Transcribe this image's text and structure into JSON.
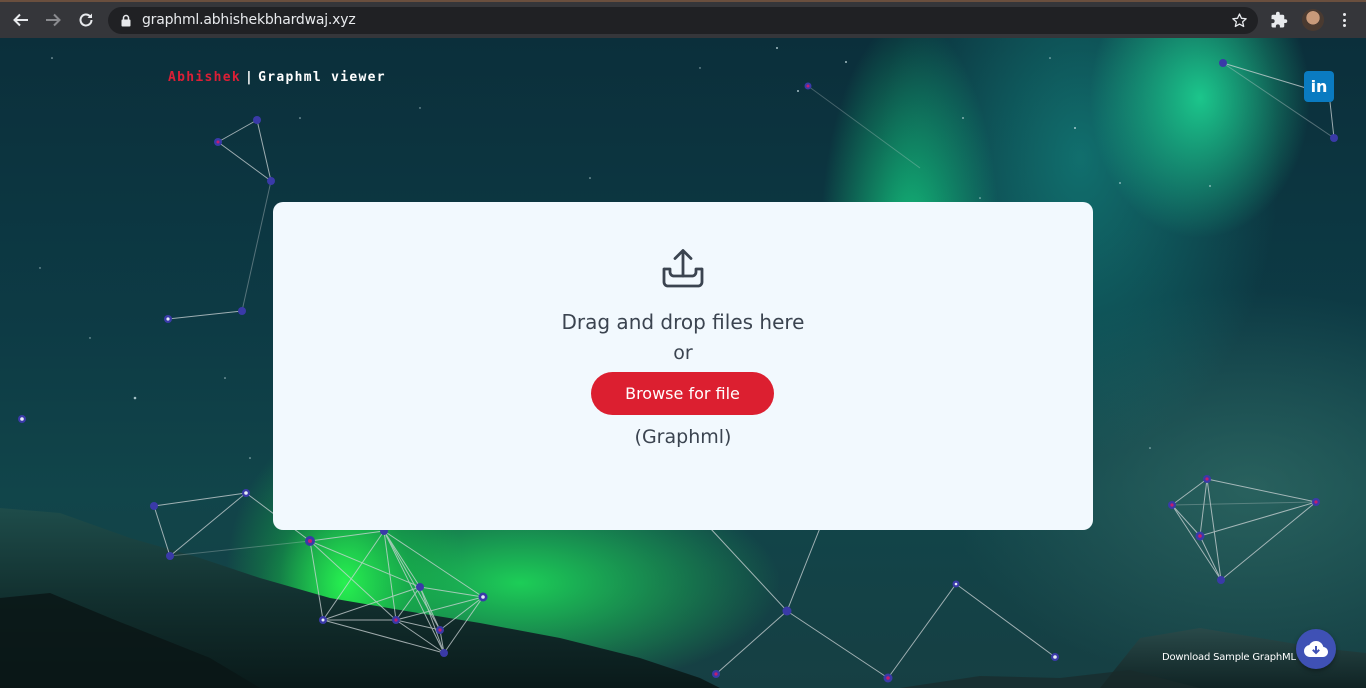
{
  "browser": {
    "url": "graphml.abhishekbhardwaj.xyz",
    "back_icon": "arrow-left-icon",
    "forward_icon": "arrow-right-icon",
    "reload_icon": "reload-icon",
    "lock_icon": "lock-icon",
    "bookmark_icon": "star-icon",
    "extensions_icon": "puzzle-icon",
    "profile_icon": "avatar",
    "menu_icon": "kebab-menu-icon"
  },
  "header": {
    "brand_name": "Abhishek",
    "separator": "|",
    "app_name": "Graphml viewer"
  },
  "social": {
    "linkedin_label": "in"
  },
  "dropzone": {
    "icon": "upload-tray-icon",
    "drag_text": "Drag and drop files here",
    "or_text": "or",
    "browse_label": "Browse for file",
    "file_type": "(Graphml)"
  },
  "download": {
    "label": "Download Sample GraphML",
    "icon": "cloud-download-icon"
  },
  "colors": {
    "accent_red": "#dc1f30",
    "linkedin_blue": "#0a7bc1",
    "download_button": "#3f51b5",
    "dropzone_bg": "#f2f9fe",
    "node_fill": "#3a3aa8",
    "edge": "#cfd6d8"
  }
}
